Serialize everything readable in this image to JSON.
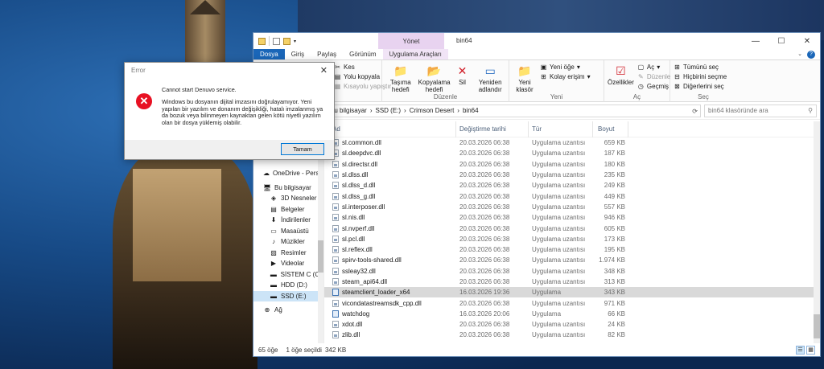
{
  "explorer": {
    "ctx_tab_head": "Yönet",
    "window_title": "bin64",
    "tabs": [
      "Dosya",
      "Giriş",
      "Paylaş",
      "Görünüm",
      "Uygulama Araçları"
    ],
    "ribbon": {
      "clipboard": {
        "cut": "Kes",
        "copy_path": "Yolu kopyala",
        "paste_shortcut": "Kısayolu yapıştır"
      },
      "organize": {
        "move_to": "Taşıma hedefi",
        "copy_to": "Kopyalama hedefi",
        "delete": "Sil",
        "rename": "Yeniden adlandır",
        "label": "Düzenle"
      },
      "new": {
        "new_folder": "Yeni klasör",
        "new_item": "Yeni öğe",
        "easy_access": "Kolay erişim",
        "label": "Yeni"
      },
      "open": {
        "properties": "Özellikler",
        "open": "Aç",
        "edit": "Düzenle",
        "history": "Geçmiş",
        "label": "Aç"
      },
      "select": {
        "select_all": "Tümünü seç",
        "select_none": "Hiçbirini seçme",
        "invert": "Diğerlerini seç",
        "label": "Seç"
      }
    },
    "address": [
      "Bu bilgisayar",
      "SSD (E:)",
      "Crimson Desert",
      "bin64"
    ],
    "search_placeholder": "bin64 klasöründe ara",
    "nav": [
      {
        "label": "OneDrive - Persor",
        "icon": "cloud-icon"
      },
      {
        "label": "Bu bilgisayar",
        "icon": "computer-icon"
      },
      {
        "label": "3D Nesneler",
        "icon": "cube-icon"
      },
      {
        "label": "Belgeler",
        "icon": "document-icon"
      },
      {
        "label": "İndirilenler",
        "icon": "download-icon"
      },
      {
        "label": "Masaüstü",
        "icon": "desktop-icon"
      },
      {
        "label": "Müzikler",
        "icon": "music-icon"
      },
      {
        "label": "Resimler",
        "icon": "picture-icon"
      },
      {
        "label": "Videolar",
        "icon": "video-icon"
      },
      {
        "label": "SİSTEM C (C:)",
        "icon": "drive-icon"
      },
      {
        "label": "HDD (D:)",
        "icon": "drive-icon"
      },
      {
        "label": "SSD (E:)",
        "icon": "drive-icon"
      },
      {
        "label": "Ağ",
        "icon": "network-icon"
      }
    ],
    "columns": {
      "name": "Ad",
      "date": "Değiştirme tarihi",
      "type": "Tür",
      "size": "Boyut"
    },
    "files": [
      {
        "name": "sl.common.dll",
        "date": "20.03.2026 06:38",
        "type": "Uygulama uzantısı",
        "size": "659 KB"
      },
      {
        "name": "sl.deepdvc.dll",
        "date": "20.03.2026 06:38",
        "type": "Uygulama uzantısı",
        "size": "187 KB"
      },
      {
        "name": "sl.directsr.dll",
        "date": "20.03.2026 06:38",
        "type": "Uygulama uzantısı",
        "size": "180 KB"
      },
      {
        "name": "sl.dlss.dll",
        "date": "20.03.2026 06:38",
        "type": "Uygulama uzantısı",
        "size": "235 KB"
      },
      {
        "name": "sl.dlss_d.dll",
        "date": "20.03.2026 06:38",
        "type": "Uygulama uzantısı",
        "size": "249 KB"
      },
      {
        "name": "sl.dlss_g.dll",
        "date": "20.03.2026 06:38",
        "type": "Uygulama uzantısı",
        "size": "449 KB"
      },
      {
        "name": "sl.interposer.dll",
        "date": "20.03.2026 06:38",
        "type": "Uygulama uzantısı",
        "size": "557 KB"
      },
      {
        "name": "sl.nis.dll",
        "date": "20.03.2026 06:38",
        "type": "Uygulama uzantısı",
        "size": "946 KB"
      },
      {
        "name": "sl.nvperf.dll",
        "date": "20.03.2026 06:38",
        "type": "Uygulama uzantısı",
        "size": "605 KB"
      },
      {
        "name": "sl.pcl.dll",
        "date": "20.03.2026 06:38",
        "type": "Uygulama uzantısı",
        "size": "173 KB"
      },
      {
        "name": "sl.reflex.dll",
        "date": "20.03.2026 06:38",
        "type": "Uygulama uzantısı",
        "size": "195 KB"
      },
      {
        "name": "spirv-tools-shared.dll",
        "date": "20.03.2026 06:38",
        "type": "Uygulama uzantısı",
        "size": "1.974 KB"
      },
      {
        "name": "ssleay32.dll",
        "date": "20.03.2026 06:38",
        "type": "Uygulama uzantısı",
        "size": "348 KB"
      },
      {
        "name": "steam_api64.dll",
        "date": "20.03.2026 06:38",
        "type": "Uygulama uzantısı",
        "size": "313 KB"
      },
      {
        "name": "steamclient_loader_x64",
        "date": "16.03.2026 19:36",
        "type": "Uygulama",
        "size": "343 KB",
        "kind": "exe",
        "selected": true
      },
      {
        "name": "vicondatastreamsdk_cpp.dll",
        "date": "20.03.2026 06:38",
        "type": "Uygulama uzantısı",
        "size": "971 KB"
      },
      {
        "name": "watchdog",
        "date": "16.03.2026 20:06",
        "type": "Uygulama",
        "size": "66 KB",
        "kind": "exe"
      },
      {
        "name": "xdot.dll",
        "date": "20.03.2026 06:38",
        "type": "Uygulama uzantısı",
        "size": "24 KB"
      },
      {
        "name": "zlib.dll",
        "date": "20.03.2026 06:38",
        "type": "Uygulama uzantısı",
        "size": "82 KB"
      }
    ],
    "status": {
      "count": "65 öğe",
      "selected": "1 öğe seçildi",
      "size": "342 KB"
    }
  },
  "dialog": {
    "title": "Error",
    "heading": "Cannot start Denuvo service.",
    "message": "Windows bu dosyanın dijital imzasını doğrulayamıyor. Yeni yapılan bir yazılım ve donanım değişikliği, hatalı imzalanmış ya da bozuk veya bilinmeyen kaynaktan gelen kötü niyetli yazılım olan bir dosya yüklemiş olabilir.",
    "ok_label": "Tamam"
  },
  "colors": {
    "accent": "#1a66b8",
    "ctx_tab": "#e8d3f0",
    "error_red": "#e81123",
    "selected_row": "#d9d9d9"
  }
}
